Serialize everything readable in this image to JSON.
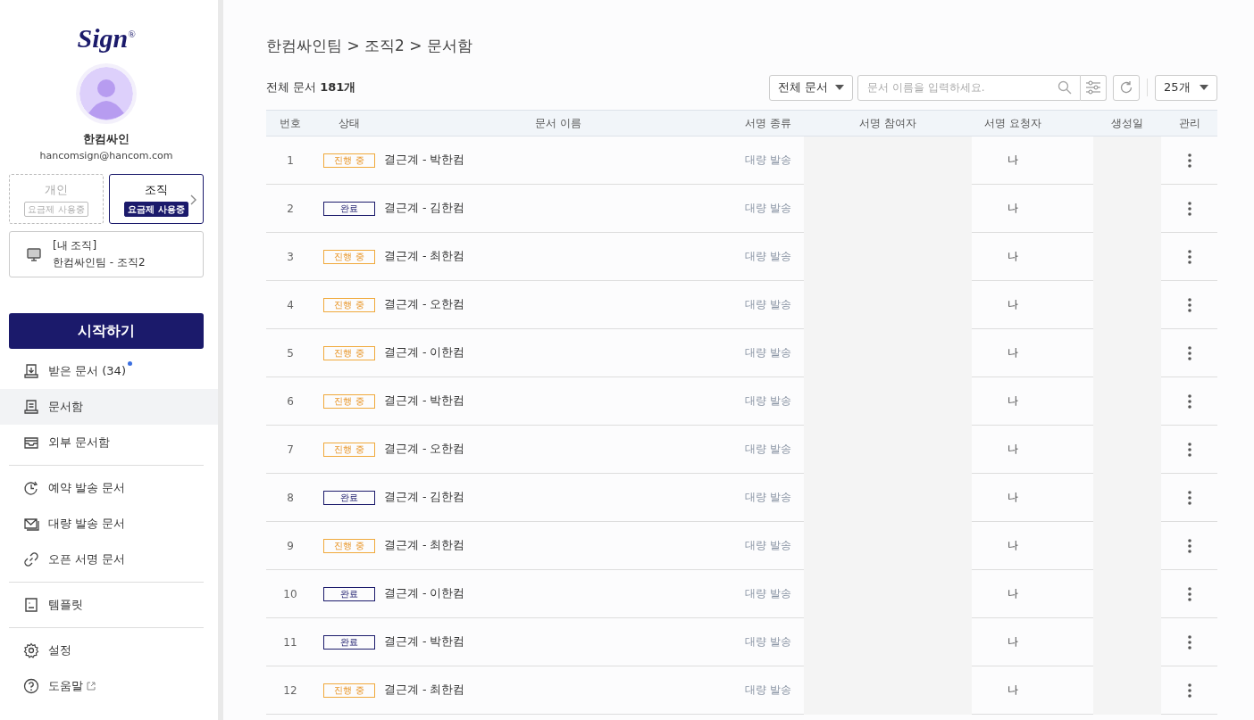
{
  "sidebar": {
    "logo": "Sign$^{®}$",
    "user": {
      "name": "한컴싸인",
      "email": "hancomsign@hancom.com"
    },
    "plans": [
      {
        "label": "개인",
        "badge": "요금제 사용중",
        "selected": false
      },
      {
        "label": "조직",
        "badge": "요금제 사용중",
        "selected": true
      }
    ],
    "organization": {
      "caption": "[내 조직]",
      "name": "한컴싸인팀 - 조직2"
    },
    "start_button": "시작하기",
    "nav_groups": [
      [
        {
          "label": "받은 문서 (34)",
          "selected": false,
          "dot": true
        },
        {
          "label": "문서함",
          "selected": true,
          "dot": false
        },
        {
          "label": "외부 문서함",
          "selected": false,
          "dot": false
        }
      ],
      [
        {
          "label": "예약 발송 문서",
          "selected": false,
          "dot": false
        },
        {
          "label": "대량 발송 문서",
          "selected": false,
          "dot": false
        },
        {
          "label": "오픈 서명 문서",
          "selected": false,
          "dot": false
        }
      ],
      [
        {
          "label": "템플릿",
          "selected": false,
          "dot": false
        }
      ],
      [
        {
          "label": "설정",
          "selected": false,
          "dot": false
        },
        {
          "label": "도움말",
          "selected": false,
          "dot": false,
          "external": true
        }
      ]
    ]
  },
  "breadcrumb": "한컴싸인팀 > 조직2 > 문서함",
  "total": "전체 문서 **181개**",
  "toolbar": {
    "filter": "전체 문서",
    "search": {
      "placeholder": "문서 이름을 입력하세요."
    },
    "page_size": "25개"
  },
  "table": {
    "columns": [
      "번호",
      "상태",
      "문서 이름",
      "서명 종류",
      "서명 참여자",
      "서명 요청자",
      "생성일",
      "관리"
    ],
    "rows": [
      {
        "no": "1",
        "status": {
          "label": "진행 중",
          "kind": "progress"
        },
        "name": "결근계 - 박한컴",
        "type": "대량 발송",
        "requester": "나"
      },
      {
        "no": "2",
        "status": {
          "label": "완료",
          "kind": "done"
        },
        "name": "결근계 - 김한컴",
        "type": "대량 발송",
        "requester": "나"
      },
      {
        "no": "3",
        "status": {
          "label": "진행 중",
          "kind": "progress"
        },
        "name": "결근계 - 최한컴",
        "type": "대량 발송",
        "requester": "나"
      },
      {
        "no": "4",
        "status": {
          "label": "진행 중",
          "kind": "progress"
        },
        "name": "결근계 - 오한컴",
        "type": "대량 발송",
        "requester": "나"
      },
      {
        "no": "5",
        "status": {
          "label": "진행 중",
          "kind": "progress"
        },
        "name": "결근계 - 이한컴",
        "type": "대량 발송",
        "requester": "나"
      },
      {
        "no": "6",
        "status": {
          "label": "진행 중",
          "kind": "progress"
        },
        "name": "결근계 - 박한컴",
        "type": "대량 발송",
        "requester": "나"
      },
      {
        "no": "7",
        "status": {
          "label": "진행 중",
          "kind": "progress"
        },
        "name": "결근계 - 오한컴",
        "type": "대량 발송",
        "requester": "나"
      },
      {
        "no": "8",
        "status": {
          "label": "완료",
          "kind": "done"
        },
        "name": "결근계 - 김한컴",
        "type": "대량 발송",
        "requester": "나"
      },
      {
        "no": "9",
        "status": {
          "label": "진행 중",
          "kind": "progress"
        },
        "name": "결근계 - 최한컴",
        "type": "대량 발송",
        "requester": "나"
      },
      {
        "no": "10",
        "status": {
          "label": "완료",
          "kind": "done"
        },
        "name": "결근계 - 이한컴",
        "type": "대량 발송",
        "requester": "나"
      },
      {
        "no": "11",
        "status": {
          "label": "완료",
          "kind": "done"
        },
        "name": "결근계 - 박한컴",
        "type": "대량 발송",
        "requester": "나"
      },
      {
        "no": "12",
        "status": {
          "label": "진행 중",
          "kind": "progress"
        },
        "name": "결근계 - 최한컴",
        "type": "대량 발송",
        "requester": "나"
      }
    ]
  }
}
